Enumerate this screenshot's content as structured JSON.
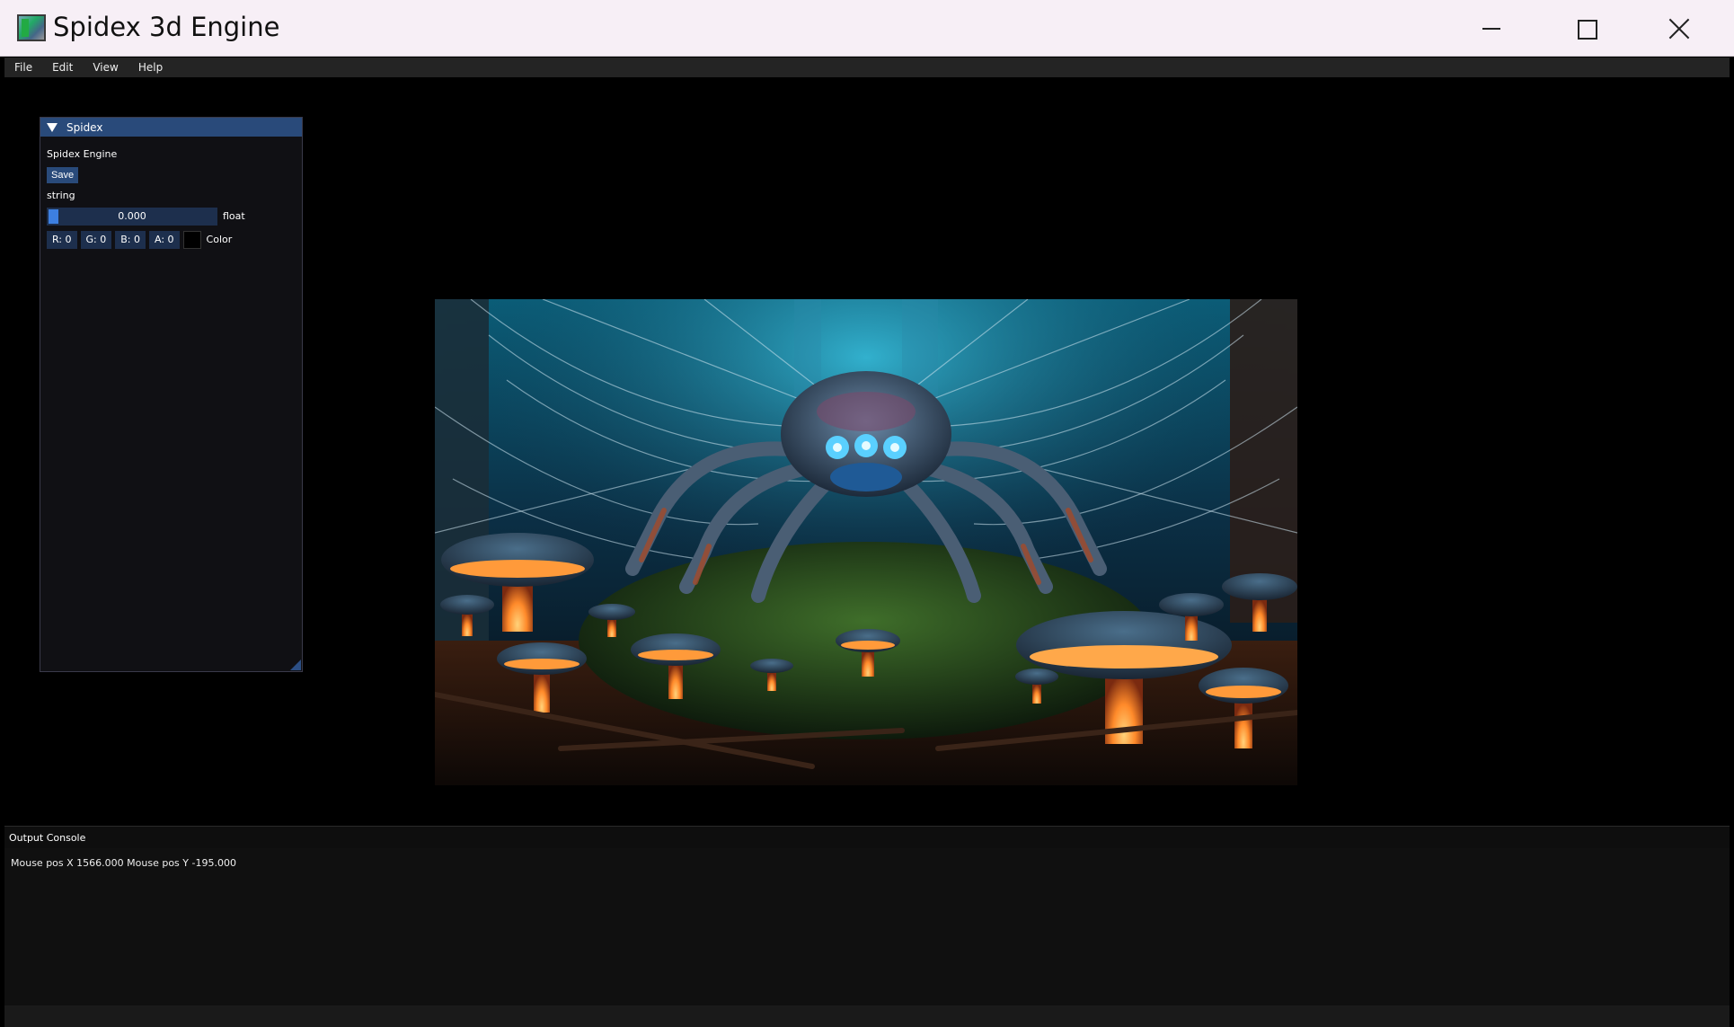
{
  "window": {
    "title": "Spidex 3d Engine"
  },
  "menubar": {
    "items": [
      "File",
      "Edit",
      "View",
      "Help"
    ]
  },
  "panel": {
    "title": "Spidex",
    "engine_label": "Spidex Engine",
    "save_label": "Save",
    "string_label": "string",
    "float_value": "0.000",
    "float_label": "float",
    "color_fields": [
      "R: 0",
      "G: 0",
      "B: 0",
      "A: 0"
    ],
    "color_label": "Color",
    "swatch_color": "#000000"
  },
  "console": {
    "title": "Output Console",
    "lines": [
      "Mouse pos X 1566.000 Mouse pos Y -195.000"
    ]
  },
  "colors": {
    "accent": "#294a7a",
    "slider_grab": "#3d7fe0"
  }
}
